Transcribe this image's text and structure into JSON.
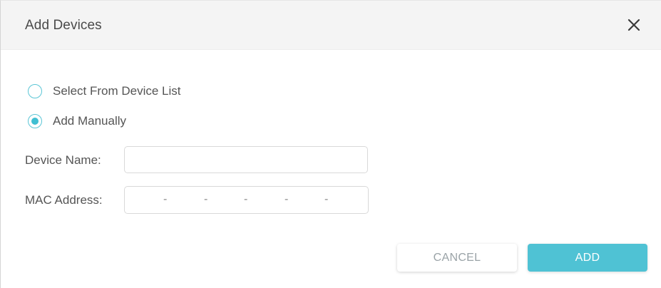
{
  "dialog": {
    "title": "Add Devices"
  },
  "mode": {
    "options": [
      {
        "label": "Select From Device List",
        "checked": false
      },
      {
        "label": "Add Manually",
        "checked": true
      }
    ]
  },
  "form": {
    "device_name_label": "Device Name:",
    "device_name_value": "",
    "mac_label": "MAC Address:",
    "mac_separator": "-",
    "mac_segments": [
      "",
      "",
      "",
      "",
      "",
      ""
    ]
  },
  "buttons": {
    "cancel_label": "CANCEL",
    "add_label": "ADD"
  },
  "colors": {
    "accent": "#4fc2d4",
    "radio_border": "#5bc6d6",
    "header_bg": "#f4f4f4",
    "cancel_text": "#9aa3a7"
  },
  "icons": {
    "close": "close-icon"
  }
}
